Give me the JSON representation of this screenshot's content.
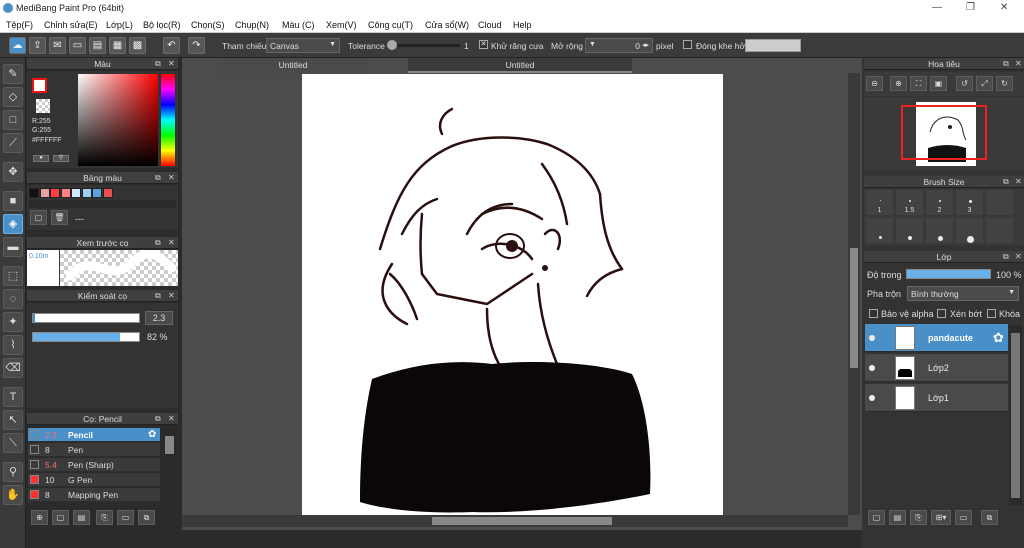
{
  "window": {
    "title": "MediBang Paint Pro (64bit)",
    "minimize": "—",
    "maximize": "❐",
    "close": "✕"
  },
  "menu": [
    "Tệp(F)",
    "Chỉnh sửa(E)",
    "Lớp(L)",
    "Bộ lọc(R)",
    "Chọn(S)",
    "Chụp(N)",
    "Màu (C)",
    "Xem(V)",
    "Công cụ(T)",
    "Cửa sổ(W)",
    "Cloud",
    "Help"
  ],
  "toolbar": {
    "reference_label": "Tham chiếu",
    "reference_value": "Canvas",
    "tolerance_label": "Tolerance",
    "tolerance_value": "1",
    "antialias_label": "Khử răng cưa",
    "expand_label": "Mở rộng",
    "expand_value": "0",
    "expand_unit": "pixel",
    "close_gap_label": "Đóng khe hở"
  },
  "color_panel": {
    "title": "Màu",
    "r": "R:255",
    "g": "G:255",
    "hex": "#FFFFFF"
  },
  "palette_panel": {
    "title": "Bảng màu",
    "name": "---",
    "swatches": [
      "#111111",
      "#e8a0a0",
      "#ff4040",
      "#ff8080",
      "#d0e8ff",
      "#a0d0f0",
      "#60a0e0",
      "#e85050"
    ]
  },
  "brush_preview": {
    "title": "Xem trước cọ",
    "size": "0.10m"
  },
  "brush_control": {
    "title": "Kiểm soát cọ",
    "size_value": "2.3",
    "opacity_value": "82 %",
    "opacity_fraction": 0.82,
    "size_fraction": 0.98
  },
  "brush_list": {
    "title": "Cọ: Pencil",
    "items": [
      {
        "size": "2.3",
        "name": "Pencil",
        "color": "#4a90c8",
        "selected": true
      },
      {
        "size": "8",
        "name": "Pen",
        "color": "#3a3a3a",
        "selected": false
      },
      {
        "size": "5.4",
        "name": "Pen (Sharp)",
        "color": "#3a3a3a",
        "selected": false
      },
      {
        "size": "10",
        "name": "G Pen",
        "color": "#ff3030",
        "selected": false
      },
      {
        "size": "8",
        "name": "Mapping Pen",
        "color": "#ff3030",
        "selected": false
      }
    ]
  },
  "tabs": [
    "Untitled",
    "Untitled"
  ],
  "navigator": {
    "title": "Hoa tiêu"
  },
  "brush_size": {
    "title": "Brush Size",
    "values": [
      "1",
      "1.5",
      "2",
      "3"
    ]
  },
  "layers": {
    "title": "Lớp",
    "opacity_label": "Độ trong",
    "opacity_value": "100 %",
    "blend_label": "Pha trộn",
    "blend_value": "Bình thường",
    "protect_alpha": "Bảo vệ alpha",
    "clipping": "Xén bớt",
    "lock": "Khóa",
    "items": [
      {
        "name": "pandacute",
        "selected": true
      },
      {
        "name": "Lớp2",
        "selected": false
      },
      {
        "name": "Lớp1",
        "selected": false
      }
    ]
  }
}
